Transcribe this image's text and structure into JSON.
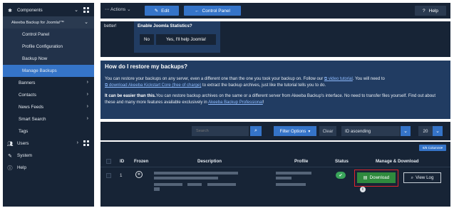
{
  "sidebar": {
    "components": "Components",
    "akeeba": "Akeeba Backup for Joomla!™",
    "items": [
      {
        "label": "Control Panel"
      },
      {
        "label": "Profile Configuration"
      },
      {
        "label": "Backup Now"
      },
      {
        "label": "Manage Backups"
      }
    ],
    "sections": [
      {
        "label": "Banners"
      },
      {
        "label": "Contacts"
      },
      {
        "label": "News Feeds"
      },
      {
        "label": "Smart Search"
      },
      {
        "label": "Tags"
      }
    ],
    "users": "Users",
    "system": "System",
    "help": "Help"
  },
  "toolbar": {
    "actions": "Actions",
    "edit": "Edit",
    "control_panel": "Control Panel",
    "help": "Help"
  },
  "stats": {
    "better": "better!",
    "title": "Enable Joomla Statistics?",
    "no": "No",
    "yes": "Yes, I'll help Joomla!"
  },
  "restore": {
    "title": "How do I restore my backups?",
    "p1a": "You can restore your backups on any server, even a different one than the one you took your backup on. Follow our ",
    "p1link1": "video tutorial",
    "p1b": ". You will need to",
    "p1link2": "download Akeeba Kickstart Core (free of charge)",
    "p1c": " to extract the backup archives, just like the tutorial tells you to do.",
    "p2bold": "It can be easier than this.",
    "p2a": "You can restore backup archives on the same or a different server from Akeeba Backup's interface. No need to transfer files yourself. Find out about these and many more features available exclusively in ",
    "p2link": "Akeeba Backup Professional",
    "p2b": "!"
  },
  "filter": {
    "search_placeholder": "Search",
    "options": "Filter Options",
    "clear": "Clear",
    "sort": "ID ascending",
    "limit": "20"
  },
  "table": {
    "columns_btn": "6/6 Columns",
    "headers": {
      "id": "ID",
      "frozen": "Frozen",
      "description": "Description",
      "profile": "Profile",
      "status": "Status",
      "manage": "Manage & Download"
    },
    "rows": [
      {
        "id": "1"
      }
    ],
    "download": "Download",
    "view_log": "View Log"
  },
  "colors": {
    "sidebar_bg": "#172436",
    "accent": "#3574c8",
    "panel": "#213c62",
    "success": "#2f8a3e",
    "highlight_outline": "#e0242c"
  }
}
